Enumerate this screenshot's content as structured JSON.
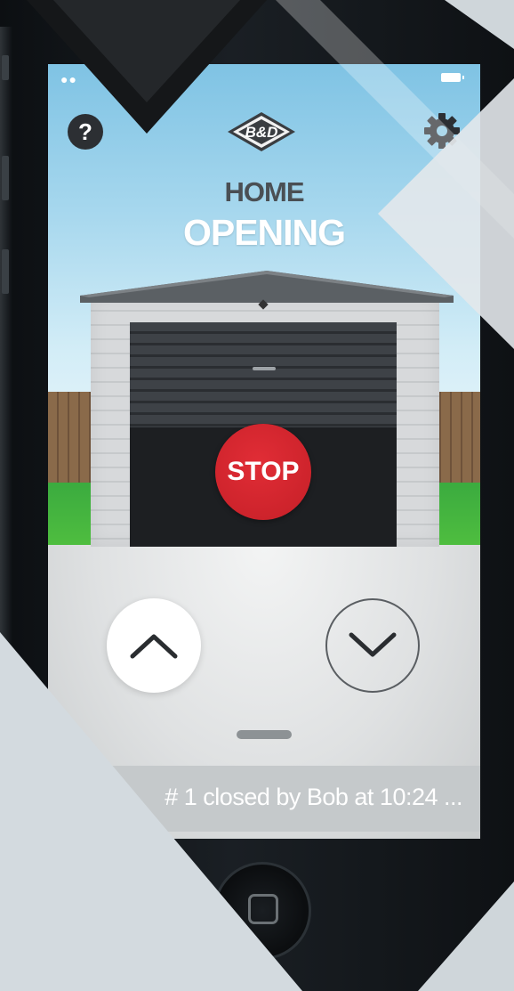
{
  "app": {
    "brand": "B&D",
    "site_name": "HOME",
    "door_status": "OPENING"
  },
  "controls": {
    "stop_label": "STOP",
    "open_icon": "chevron-up-icon",
    "close_icon": "chevron-down-icon",
    "help_label": "?",
    "settings_icon": "gear-icon"
  },
  "notification": {
    "text": "# 1 closed by Bob at 10:24 ..."
  },
  "status_bar": {
    "signal": "●●",
    "battery_icon": "battery-icon"
  },
  "colors": {
    "stop_red": "#d1232c",
    "sky_blue": "#8fcbe7",
    "status_text_white": "#ffffff"
  }
}
